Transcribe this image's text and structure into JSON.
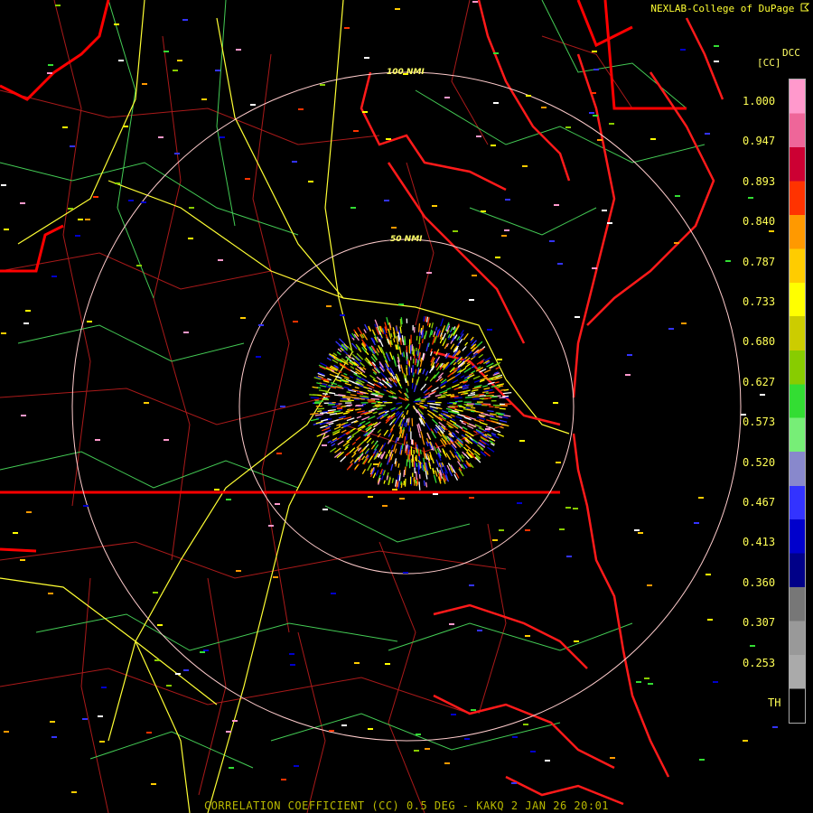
{
  "header": {
    "credit": "NEXLAB-College of DuPage",
    "credit_icon": "logo-mark-icon"
  },
  "legend": {
    "product_code": "DCC",
    "unit": "[CC]",
    "ticks": [
      "1.000",
      "0.947",
      "0.893",
      "0.840",
      "0.787",
      "0.733",
      "0.680",
      "0.627",
      "0.573",
      "0.520",
      "0.467",
      "0.413",
      "0.360",
      "0.307",
      "0.253",
      "TH"
    ],
    "colors": [
      "#ff99cc",
      "#ee6699",
      "#cc0033",
      "#ff3300",
      "#ff9900",
      "#ffcc00",
      "#ffff00",
      "#cccc00",
      "#88cc00",
      "#33dd33",
      "#77ee77",
      "#8888cc",
      "#3333ff",
      "#0000cc",
      "#000088",
      "#777777",
      "#999999",
      "#aaaaaa",
      "#000000"
    ]
  },
  "map": {
    "range_rings": [
      {
        "label": "50 NMI"
      },
      {
        "label": "100 NMI"
      }
    ],
    "colors": {
      "state_border": "#ff0000",
      "county": "#cc2222",
      "roads": "#ffff33",
      "rivers": "#66dd66",
      "rings": "#ffcccc"
    }
  },
  "footer": {
    "product_line": "CORRELATION COEFFICIENT (CC) 0.5 DEG - KAKQ 2 JAN 26 20:01"
  }
}
